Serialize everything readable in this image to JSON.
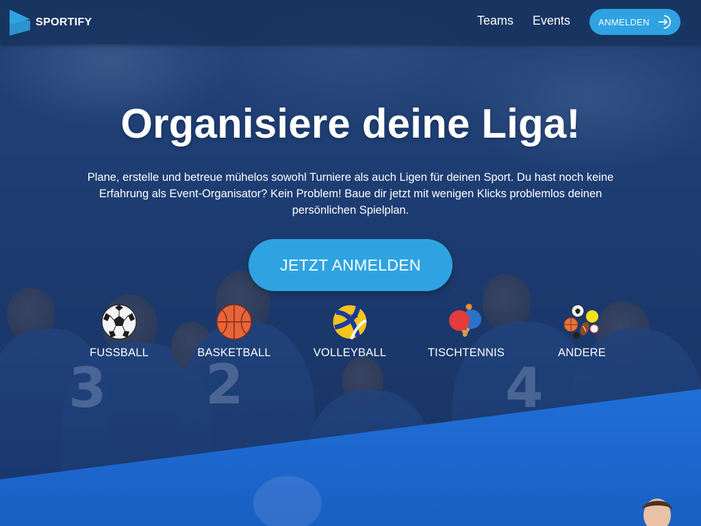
{
  "navbar": {
    "brand_name": "SPORTIFY",
    "links": [
      {
        "label": "Teams"
      },
      {
        "label": "Events"
      }
    ],
    "login_button": {
      "label": "ANMELDEN",
      "icon": "login-arrow-icon"
    }
  },
  "hero": {
    "title": "Organisiere deine Liga!",
    "text": "Plane, erstelle und betreue mühelos sowohl Turniere als auch Ligen für deinen Sport. Du hast noch keine Erfahrung als Event-Organisator? Kein Problem! Baue dir jetzt mit wenigen Klicks problemlos deinen persönlichen Spielplan.",
    "cta_label": "JETZT ANMELDEN"
  },
  "sports": [
    {
      "label": "FUSSBALL",
      "icon": "soccer-ball-icon"
    },
    {
      "label": "BASKETBALL",
      "icon": "basketball-icon"
    },
    {
      "label": "VOLLEYBALL",
      "icon": "volleyball-icon"
    },
    {
      "label": "TISCHTENNIS",
      "icon": "table-tennis-icon"
    },
    {
      "label": "ANDERE",
      "icon": "various-balls-icon"
    }
  ],
  "colors": {
    "accent": "#2fa3e2",
    "navbar": "#183460",
    "bottom_section": "#1f6fd6"
  }
}
